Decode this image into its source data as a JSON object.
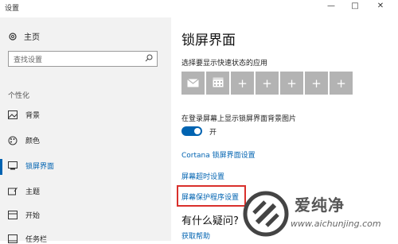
{
  "window": {
    "title": "设置",
    "minimize": "—",
    "maximize": "□",
    "close": "✕"
  },
  "sidebar": {
    "home_label": "主页",
    "search_placeholder": "查找设置",
    "section_label": "个性化",
    "items": [
      {
        "label": "背景",
        "icon": "image-icon"
      },
      {
        "label": "颜色",
        "icon": "palette-icon"
      },
      {
        "label": "锁屏界面",
        "icon": "lock-screen-icon",
        "active": true
      },
      {
        "label": "主题",
        "icon": "theme-icon"
      },
      {
        "label": "开始",
        "icon": "start-icon"
      },
      {
        "label": "任务栏",
        "icon": "taskbar-icon"
      }
    ]
  },
  "main": {
    "title": "锁屏界面",
    "quick_status_label": "选择要显示快速状态的应用",
    "quick_apps": [
      "mail",
      "calendar",
      "+",
      "+",
      "+",
      "+",
      "+"
    ],
    "show_background_label": "在登录屏幕上显示锁屏界面背景图片",
    "toggle_state": "开",
    "toggle_on": true,
    "links": {
      "cortana": "Cortana 锁屏界面设置",
      "timeout": "屏幕超时设置",
      "screensaver": "屏幕保护程序设置"
    },
    "help_title": "有什么疑问?",
    "help_link": "获取帮助"
  },
  "watermark": {
    "brand": "爱纯净",
    "url": "www.aichunjing.com"
  },
  "colors": {
    "accent": "#0063b1",
    "highlight": "#d9302c",
    "sidebar_bg": "#f2f2f2",
    "tile_bg": "#b3b3b3"
  }
}
